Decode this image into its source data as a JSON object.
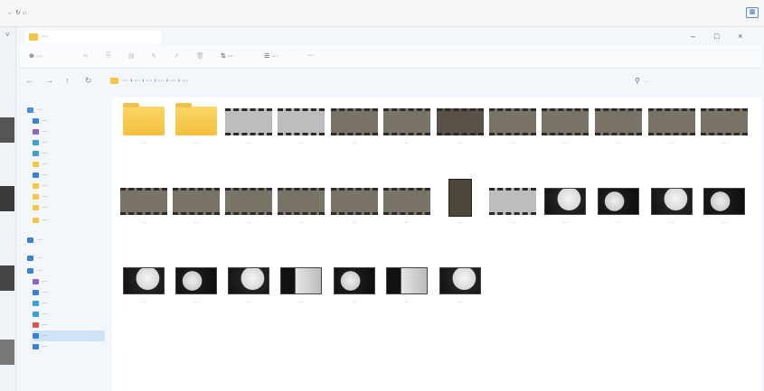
{
  "browser": {
    "address_text": "← ↻ ⌂",
    "extension_icon": "grid-icon"
  },
  "window": {
    "tab_title": "···",
    "controls": [
      "–",
      "□",
      "×"
    ]
  },
  "command_bar": {
    "new_label": "⊕ ···",
    "sort_label": "⇅ ···",
    "view_label": "☰ ···",
    "more_label": "···"
  },
  "navigation": {
    "back_icon": "←",
    "forward_icon": "→",
    "up_icon": "↑",
    "refresh_icon": "↻",
    "breadcrumbs": "··· › ··· › ··· › ··· › ··· › ···",
    "search_placeholder": "···"
  },
  "nav_pane": {
    "items": [
      {
        "label": "···",
        "color": "#4a90e2"
      },
      {
        "label": "···",
        "color": "#3b82d6"
      },
      {
        "label": "···",
        "color": "#8e63c9"
      },
      {
        "label": "···",
        "color": "#3aa0d8"
      },
      {
        "label": "···",
        "color": "#3aa0d8"
      },
      {
        "label": "···",
        "color": "#f4c542"
      },
      {
        "label": "···",
        "color": "#3b82d6"
      },
      {
        "label": "···",
        "color": "#f4c542"
      },
      {
        "label": "···",
        "color": "#f4c542"
      },
      {
        "label": "···",
        "color": "#f4c542"
      },
      {
        "label": "···",
        "color": "#f4c542"
      },
      {
        "label": "···",
        "color": "#3b82d6"
      },
      {
        "label": "···",
        "color": "#3b82d6"
      },
      {
        "label": "···",
        "color": "#3b82d6"
      },
      {
        "label": "···",
        "color": "#8e63c9"
      },
      {
        "label": "···",
        "color": "#3b82d6"
      },
      {
        "label": "···",
        "color": "#3aa0d8"
      },
      {
        "label": "···",
        "color": "#3aa0d8"
      },
      {
        "label": "···",
        "color": "#d9534f"
      },
      {
        "label": "···",
        "color": "#3b82d6"
      },
      {
        "label": "···",
        "color": "#3b82d6"
      }
    ]
  },
  "files": [
    {
      "label": "···",
      "kind": "folder"
    },
    {
      "label": "···",
      "kind": "folder"
    },
    {
      "label": "···",
      "kind": "video-gray"
    },
    {
      "label": "···",
      "kind": "video-gray"
    },
    {
      "label": "···",
      "kind": "video"
    },
    {
      "label": "···",
      "kind": "video"
    },
    {
      "label": "···",
      "kind": "video-dark"
    },
    {
      "label": "···",
      "kind": "video"
    },
    {
      "label": "···",
      "kind": "video"
    },
    {
      "label": "···",
      "kind": "video"
    },
    {
      "label": "···",
      "kind": "video"
    },
    {
      "label": "···",
      "kind": "video"
    },
    {
      "label": "···",
      "kind": "video"
    },
    {
      "label": "···",
      "kind": "video"
    },
    {
      "label": "···",
      "kind": "video"
    },
    {
      "label": "···",
      "kind": "video"
    },
    {
      "label": "···",
      "kind": "video"
    },
    {
      "label": "···",
      "kind": "video"
    },
    {
      "label": "···",
      "kind": "portrait"
    },
    {
      "label": "···",
      "kind": "video-gray"
    },
    {
      "label": "···",
      "kind": "photo"
    },
    {
      "label": "···",
      "kind": "photo-b"
    },
    {
      "label": "···",
      "kind": "photo"
    },
    {
      "label": "···",
      "kind": "photo-b"
    },
    {
      "label": "···",
      "kind": "photo"
    },
    {
      "label": "···",
      "kind": "photo-b"
    },
    {
      "label": "···",
      "kind": "photo"
    },
    {
      "label": "···",
      "kind": "photo-c"
    },
    {
      "label": "···",
      "kind": "photo-b"
    },
    {
      "label": "···",
      "kind": "photo-c"
    },
    {
      "label": "···",
      "kind": "photo"
    }
  ]
}
